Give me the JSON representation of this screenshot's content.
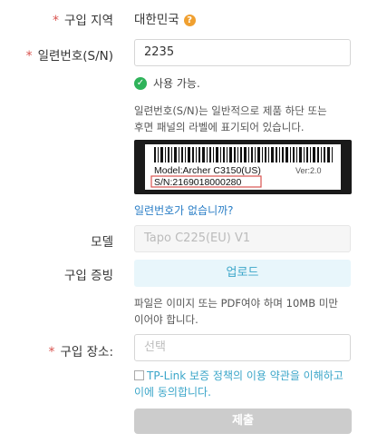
{
  "purchase_region": {
    "label": "구입 지역",
    "value": "대한민국",
    "help_icon": "?"
  },
  "serial": {
    "label": "일련번호(S/N)",
    "value": "2235"
  },
  "status": {
    "text": "사용 가능.",
    "icon": "check-icon",
    "color": "#2fb35a"
  },
  "serial_hint": {
    "line1": "일련번호(S/N)는 일반적으로 제품 하단 또는",
    "line2": "후면 패널의 라벨에 표기되어 있습니다."
  },
  "barcode_label": {
    "model": "Model:Archer C3150(US)",
    "ver": "Ver:2.0",
    "sn": "S/N:2169018000280"
  },
  "no_serial_link": "일련번호가 없습니까?",
  "model": {
    "label": "모델",
    "placeholder": "Tapo C225(EU) V1"
  },
  "proof": {
    "label": "구입 증빙",
    "button": "업로드",
    "hint_line1": "파일은 이미지 또는 PDF여야 하며 10MB 미만",
    "hint_line2": "이어야 합니다."
  },
  "place": {
    "label": "구입 장소:",
    "placeholder": "선택"
  },
  "agreement": {
    "line1": "TP-Link 보증 정책의 이용 약관을 이해하고",
    "line2": "이에 동의합니다."
  },
  "submit_label": "제출",
  "colors": {
    "required": "#d9534f",
    "accent": "#3ba6c9",
    "link": "#2a7ec6",
    "help": "#f0a030"
  }
}
